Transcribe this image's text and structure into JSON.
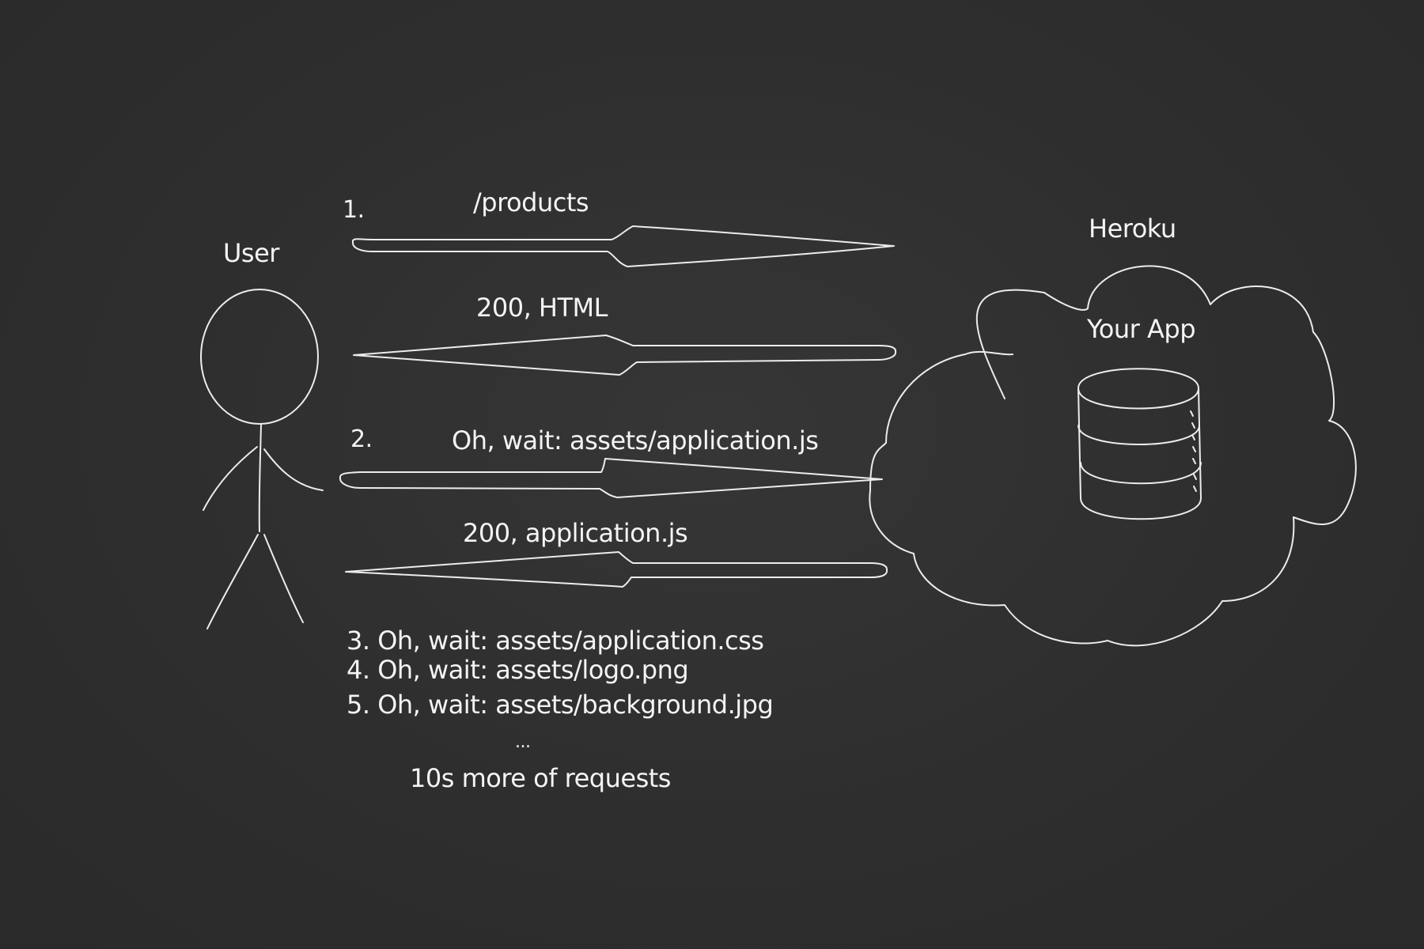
{
  "actors": {
    "user_label": "User",
    "server_label": "Heroku",
    "app_label": "Your App"
  },
  "steps": {
    "step1_number": "1.",
    "step1_request": "/products",
    "step1_response": "200, HTML",
    "step2_number": "2.",
    "step2_request": "Oh, wait: assets/application.js",
    "step2_response": "200, application.js"
  },
  "more_requests": [
    "3. Oh, wait: assets/application.css",
    "4. Oh, wait: assets/logo.png",
    "5. Oh, wait: assets/background.jpg"
  ],
  "ellipsis": "...",
  "footer_note": "10s more of requests",
  "colors": {
    "chalkboard": "#2f2f2f",
    "chalk": "#ececec"
  }
}
